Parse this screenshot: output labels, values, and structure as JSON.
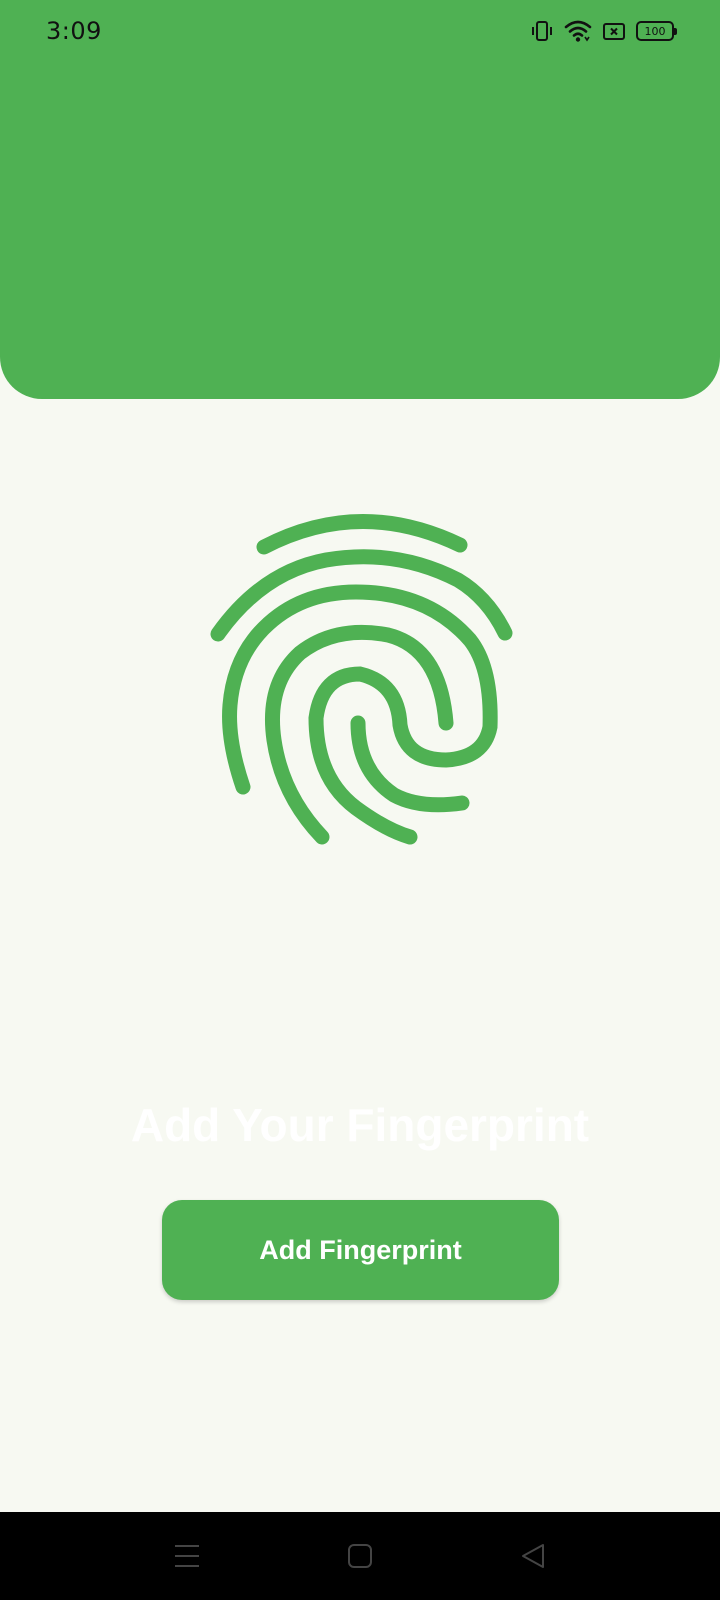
{
  "status_bar": {
    "time": "3:09",
    "battery_level": "100",
    "icons": [
      "vibrate-icon",
      "wifi-icon",
      "sim-error-icon",
      "battery-icon"
    ]
  },
  "main": {
    "prompt_title": "Add Your Fingerprint",
    "fingerprint_icon": "fingerprint-icon",
    "add_button_label": "Add Fingerprint"
  },
  "nav_bar": {
    "buttons": [
      "menu-icon",
      "home-icon",
      "back-icon"
    ]
  },
  "colors": {
    "accent": "#4fb153",
    "background": "#f7f9f2",
    "button_text": "#ffffff",
    "nav_background": "#000000"
  }
}
